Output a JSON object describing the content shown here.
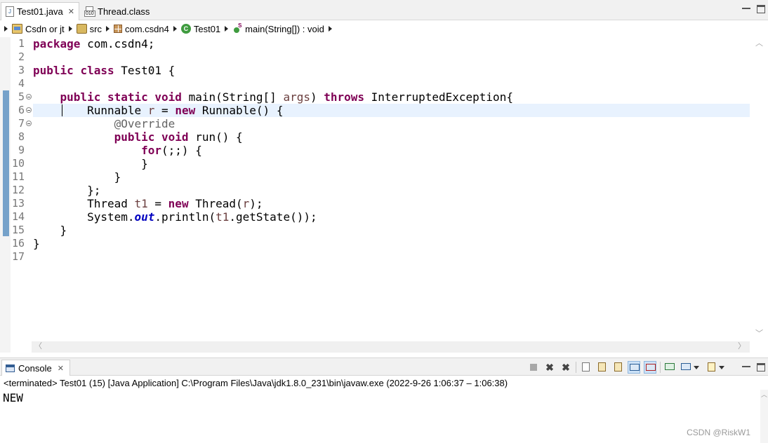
{
  "editor_tabs": [
    {
      "label": "Test01.java",
      "icon": "java-file-icon",
      "active": true,
      "closable": true
    },
    {
      "label": "Thread.class",
      "icon": "class-file-icon",
      "active": false,
      "closable": false
    }
  ],
  "breadcrumb": [
    {
      "label": "Csdn or jt",
      "icon": "project-icon"
    },
    {
      "label": "src",
      "icon": "source-folder-icon"
    },
    {
      "label": "com.csdn4",
      "icon": "package-icon"
    },
    {
      "label": "Test01",
      "icon": "class-icon"
    },
    {
      "label": "main(String[]) : void",
      "icon": "method-icon"
    }
  ],
  "editor": {
    "current_line": 6,
    "lines": [
      {
        "n": "1",
        "tokens": [
          {
            "t": "package",
            "c": "kw"
          },
          {
            "t": " com.csdn4;"
          }
        ]
      },
      {
        "n": "2",
        "tokens": []
      },
      {
        "n": "3",
        "tokens": [
          {
            "t": "public",
            "c": "kw"
          },
          {
            "t": " "
          },
          {
            "t": "class",
            "c": "kw"
          },
          {
            "t": " Test01 {"
          }
        ]
      },
      {
        "n": "4",
        "tokens": []
      },
      {
        "n": "5",
        "fold": true,
        "tokens": [
          {
            "t": "    "
          },
          {
            "t": "public",
            "c": "kw"
          },
          {
            "t": " "
          },
          {
            "t": "static",
            "c": "kw"
          },
          {
            "t": " "
          },
          {
            "t": "void",
            "c": "kw"
          },
          {
            "t": " main(String[] "
          },
          {
            "t": "args",
            "c": "var"
          },
          {
            "t": ") "
          },
          {
            "t": "throws",
            "c": "kw"
          },
          {
            "t": " InterruptedException{"
          }
        ]
      },
      {
        "n": "6",
        "fold": true,
        "tokens": [
          {
            "t": "        Runnable "
          },
          {
            "t": "r",
            "c": "var"
          },
          {
            "t": " = "
          },
          {
            "t": "new",
            "c": "kw"
          },
          {
            "t": " Runnable() {"
          }
        ]
      },
      {
        "n": "7",
        "fold": true,
        "tokens": [
          {
            "t": "            "
          },
          {
            "t": "@Override",
            "c": "ann"
          }
        ]
      },
      {
        "n": "8",
        "tokens": [
          {
            "t": "            "
          },
          {
            "t": "public",
            "c": "kw"
          },
          {
            "t": " "
          },
          {
            "t": "void",
            "c": "kw"
          },
          {
            "t": " run() {"
          }
        ]
      },
      {
        "n": "9",
        "tokens": [
          {
            "t": "                "
          },
          {
            "t": "for",
            "c": "kw"
          },
          {
            "t": "(;;) {"
          }
        ]
      },
      {
        "n": "10",
        "tokens": [
          {
            "t": "                }"
          }
        ]
      },
      {
        "n": "11",
        "tokens": [
          {
            "t": "            }"
          }
        ]
      },
      {
        "n": "12",
        "tokens": [
          {
            "t": "        };"
          }
        ]
      },
      {
        "n": "13",
        "tokens": [
          {
            "t": "        Thread "
          },
          {
            "t": "t1",
            "c": "var"
          },
          {
            "t": " = "
          },
          {
            "t": "new",
            "c": "kw"
          },
          {
            "t": " Thread("
          },
          {
            "t": "r",
            "c": "var"
          },
          {
            "t": ");"
          }
        ]
      },
      {
        "n": "14",
        "tokens": [
          {
            "t": "        System."
          },
          {
            "t": "out",
            "c": "static"
          },
          {
            "t": ".println("
          },
          {
            "t": "t1",
            "c": "var"
          },
          {
            "t": ".getState());"
          }
        ]
      },
      {
        "n": "15",
        "tokens": [
          {
            "t": "    }"
          }
        ]
      },
      {
        "n": "16",
        "tokens": [
          {
            "t": "}"
          }
        ]
      },
      {
        "n": "17",
        "tokens": []
      }
    ]
  },
  "console": {
    "tab_label": "Console",
    "status": "<terminated> Test01 (15) [Java Application] C:\\Program Files\\Java\\jdk1.8.0_231\\bin\\javaw.exe  (2022-9-26 1:06:37 – 1:06:38)",
    "output": "NEW",
    "toolbar": [
      "terminate-icon",
      "remove-launch-icon",
      "remove-all-launches-icon",
      "clear-console-icon",
      "scroll-lock-icon",
      "word-wrap-icon",
      "show-on-stdout-icon",
      "show-on-stderr-icon",
      "pin-console-icon",
      "display-selected-console-icon",
      "open-console-icon"
    ]
  },
  "colors": {
    "keyword": "#7f0055",
    "annotation": "#646464",
    "local_variable": "#6a3e3e",
    "static_field": "#0000c0",
    "line_numbers": "#787878",
    "current_line_highlight": "#e8f2fe",
    "change_bar": "#5f93c2"
  },
  "watermark": "CSDN @RiskW1"
}
